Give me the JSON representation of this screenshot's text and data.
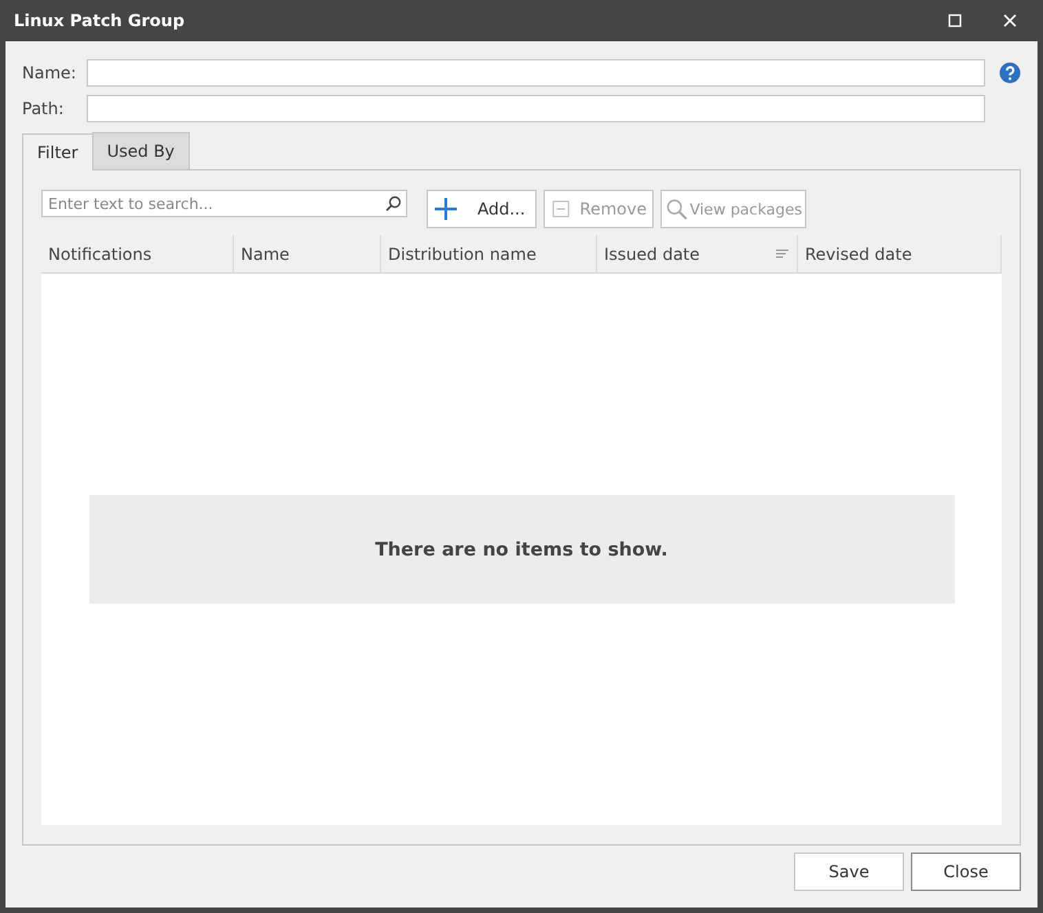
{
  "window": {
    "title": "Linux Patch Group"
  },
  "fields": [
    {
      "label": "Name:",
      "help": true
    },
    {
      "label": "Path:",
      "help": false
    }
  ],
  "tabs": [
    {
      "label": "Filter",
      "selected": true
    },
    {
      "label": "Used By",
      "selected": false
    }
  ],
  "search": {
    "placeholder": "Enter text to search..."
  },
  "toolbar": [
    {
      "label": "Add...",
      "kind": "add",
      "disabled": false
    },
    {
      "label": "Remove",
      "kind": "remove",
      "disabled": true
    },
    {
      "label": "View packages",
      "kind": "view",
      "disabled": true
    }
  ],
  "table": {
    "columns": [
      {
        "label": "Notifications",
        "sorted": false
      },
      {
        "label": "Name",
        "sorted": false
      },
      {
        "label": "Distribution name",
        "sorted": false
      },
      {
        "label": "Issued date",
        "sorted": true
      },
      {
        "label": "Revised date",
        "sorted": false
      }
    ],
    "empty_message": "There are no items to show."
  },
  "buttons": [
    {
      "label": "Save",
      "kind": "save"
    },
    {
      "label": "Close",
      "kind": "close"
    }
  ]
}
